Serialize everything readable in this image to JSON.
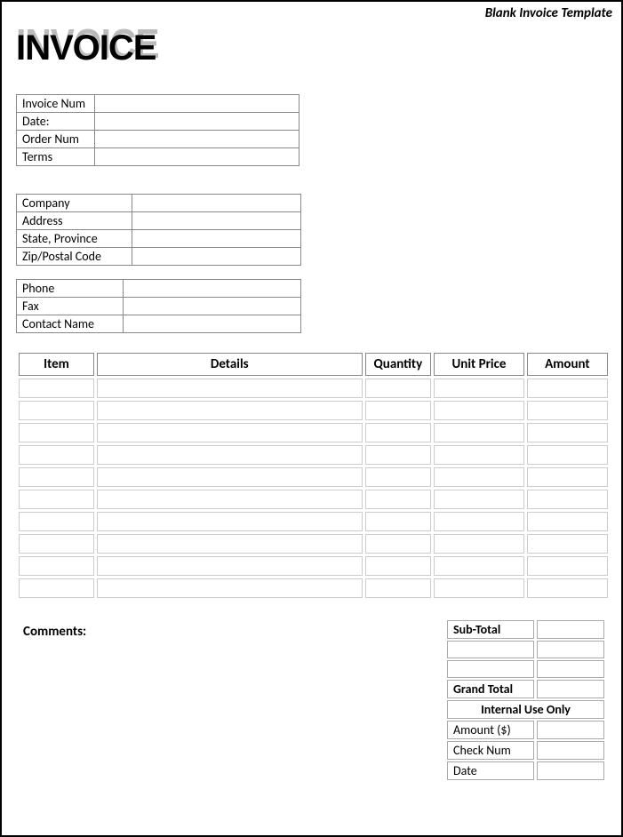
{
  "top_label": "Blank Invoice Template",
  "title": "INVOICE",
  "block1": {
    "rows": [
      {
        "label": "Invoice Num",
        "value": ""
      },
      {
        "label": "Date:",
        "value": ""
      },
      {
        "label": "Order Num",
        "value": ""
      },
      {
        "label": "Terms",
        "value": ""
      }
    ]
  },
  "block2": {
    "rows": [
      {
        "label": "Company",
        "value": ""
      },
      {
        "label": "Address",
        "value": ""
      },
      {
        "label": "State, Province",
        "value": ""
      },
      {
        "label": "Zip/Postal Code",
        "value": ""
      }
    ]
  },
  "block3": {
    "rows": [
      {
        "label": "Phone",
        "value": ""
      },
      {
        "label": "Fax",
        "value": ""
      },
      {
        "label": "Contact Name",
        "value": ""
      }
    ]
  },
  "items": {
    "headers": [
      "Item",
      "Details",
      "Quantity",
      "Unit Price",
      "Amount"
    ],
    "rows": [
      {
        "item": "",
        "details": "",
        "qty": "",
        "price": "",
        "amount": ""
      },
      {
        "item": "",
        "details": "",
        "qty": "",
        "price": "",
        "amount": ""
      },
      {
        "item": "",
        "details": "",
        "qty": "",
        "price": "",
        "amount": ""
      },
      {
        "item": "",
        "details": "",
        "qty": "",
        "price": "",
        "amount": ""
      },
      {
        "item": "",
        "details": "",
        "qty": "",
        "price": "",
        "amount": ""
      },
      {
        "item": "",
        "details": "",
        "qty": "",
        "price": "",
        "amount": ""
      },
      {
        "item": "",
        "details": "",
        "qty": "",
        "price": "",
        "amount": ""
      },
      {
        "item": "",
        "details": "",
        "qty": "",
        "price": "",
        "amount": ""
      },
      {
        "item": "",
        "details": "",
        "qty": "",
        "price": "",
        "amount": ""
      },
      {
        "item": "",
        "details": "",
        "qty": "",
        "price": "",
        "amount": ""
      }
    ]
  },
  "comments_label": "Comments:",
  "totals": {
    "subtotal_label": "Sub-Total",
    "subtotal_value": "",
    "extra1_label": "",
    "extra1_value": "",
    "extra2_label": "",
    "extra2_value": "",
    "grandtotal_label": "Grand Total",
    "grandtotal_value": "",
    "internal_header": "Internal Use Only",
    "internal": [
      {
        "label": "Amount ($)",
        "value": ""
      },
      {
        "label": "Check Num",
        "value": ""
      },
      {
        "label": "Date",
        "value": ""
      }
    ]
  }
}
